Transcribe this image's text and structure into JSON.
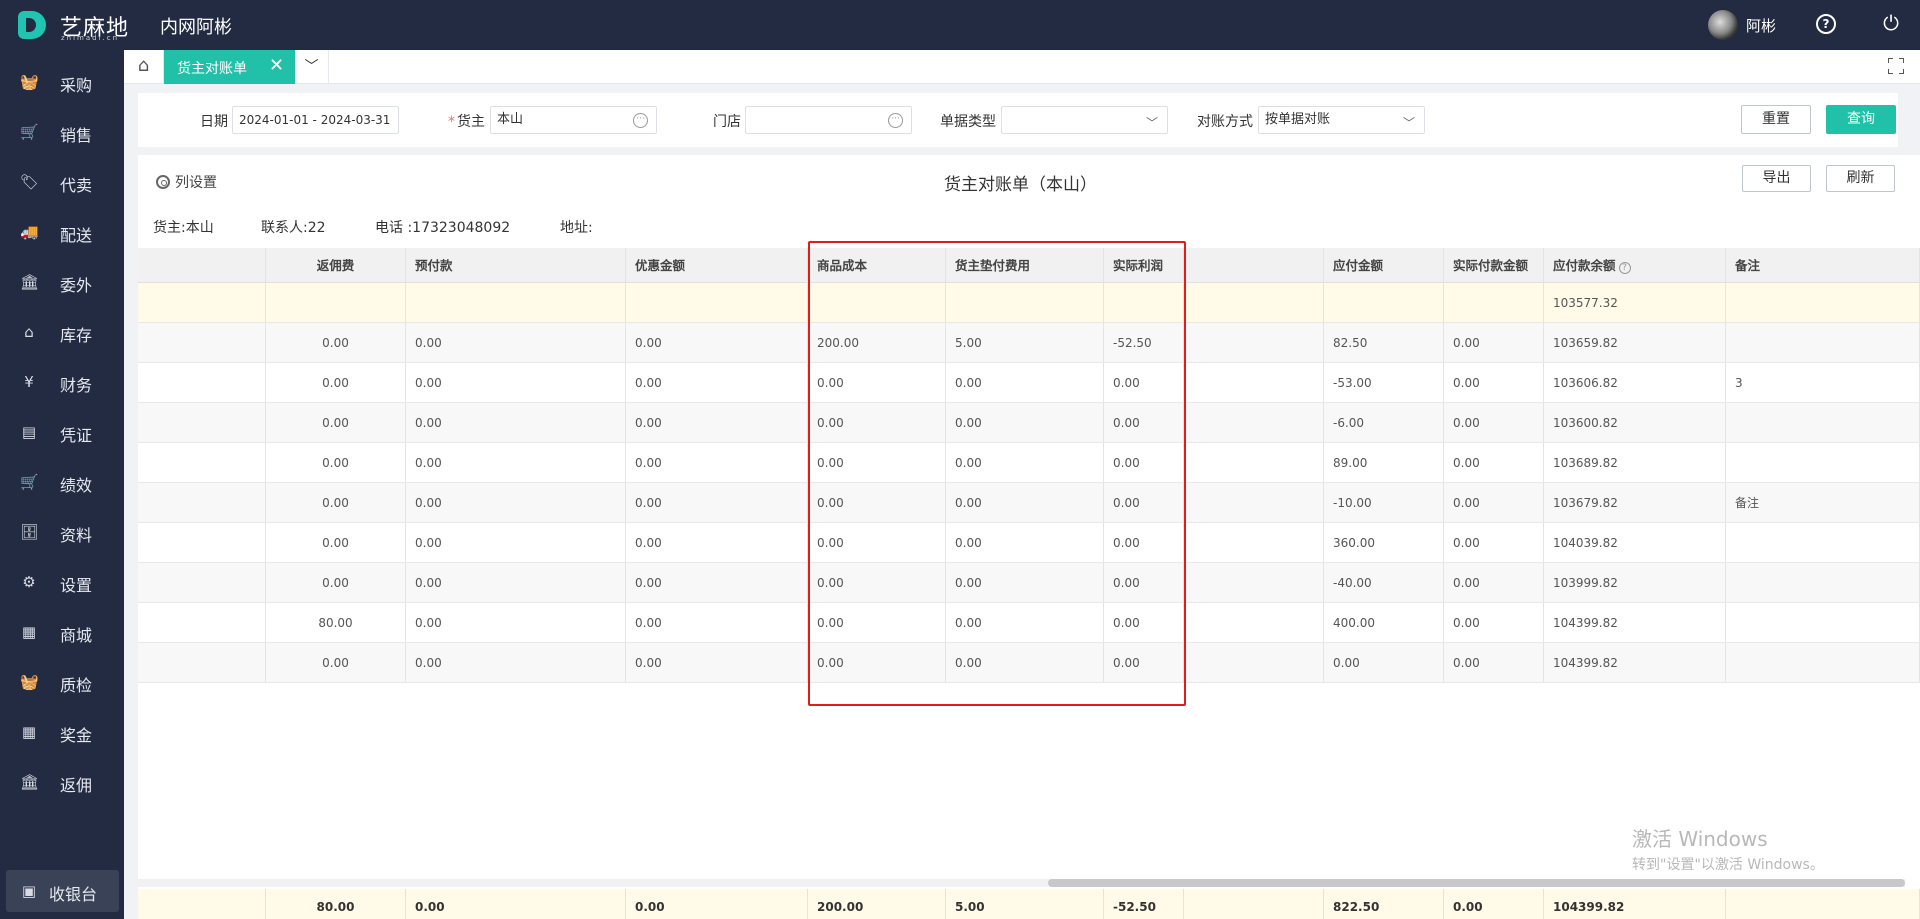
{
  "header": {
    "logo_text": "艺麻地",
    "logo_sub": "zhimadi.cn",
    "app_title": "内网阿彬",
    "user_name": "阿彬"
  },
  "sidebar": {
    "items": [
      {
        "label": "采购",
        "icon": "basket-icon"
      },
      {
        "label": "销售",
        "icon": "cart-icon"
      },
      {
        "label": "代卖",
        "icon": "tag-icon"
      },
      {
        "label": "配送",
        "icon": "truck-icon"
      },
      {
        "label": "委外",
        "icon": "building-icon"
      },
      {
        "label": "库存",
        "icon": "warehouse-icon"
      },
      {
        "label": "财务",
        "icon": "money-icon"
      },
      {
        "label": "凭证",
        "icon": "voucher-icon"
      },
      {
        "label": "绩效",
        "icon": "cart-icon"
      },
      {
        "label": "资料",
        "icon": "archive-icon"
      },
      {
        "label": "设置",
        "icon": "gear-icon"
      },
      {
        "label": "商城",
        "icon": "store-icon"
      },
      {
        "label": "质检",
        "icon": "basket-icon"
      },
      {
        "label": "奖金",
        "icon": "store-icon"
      },
      {
        "label": "返佣",
        "icon": "building-icon"
      }
    ],
    "cashier_label": "收银台"
  },
  "tabs": {
    "active_label": "货主对账单"
  },
  "filters": {
    "date_label": "日期",
    "date_value": "2024-01-01 - 2024-03-31",
    "owner_label": "货主",
    "owner_value": "本山",
    "store_label": "门店",
    "store_value": "",
    "doc_type_label": "单据类型",
    "doc_type_value": "",
    "recon_label": "对账方式",
    "recon_value": "按单据对账",
    "reset_label": "重置",
    "query_label": "查询"
  },
  "report": {
    "column_settings_label": "列设置",
    "title": "货主对账单（本山）",
    "export_label": "导出",
    "refresh_label": "刷新",
    "owner_info": "货主:本山",
    "contact_info": "联系人:22",
    "phone_info": "电话 :17323048092",
    "address_info": "地址:"
  },
  "table": {
    "columns": [
      "",
      "返佣费",
      "预付款",
      "优惠金额",
      "商品成本",
      "货主垫付费用",
      "实际利润",
      "",
      "应付金额",
      "实际付款金额",
      "应付款余额",
      "备注"
    ],
    "summary_row": [
      "",
      "",
      "",
      "",
      "",
      "",
      "",
      "",
      "",
      "",
      "103577.32",
      ""
    ],
    "rows": [
      [
        "",
        "0.00",
        "0.00",
        "0.00",
        "200.00",
        "5.00",
        "-52.50",
        "",
        "82.50",
        "0.00",
        "103659.82",
        ""
      ],
      [
        "",
        "0.00",
        "0.00",
        "0.00",
        "0.00",
        "0.00",
        "0.00",
        "",
        "-53.00",
        "0.00",
        "103606.82",
        "3"
      ],
      [
        "",
        "0.00",
        "0.00",
        "0.00",
        "0.00",
        "0.00",
        "0.00",
        "",
        "-6.00",
        "0.00",
        "103600.82",
        ""
      ],
      [
        "",
        "0.00",
        "0.00",
        "0.00",
        "0.00",
        "0.00",
        "0.00",
        "",
        "89.00",
        "0.00",
        "103689.82",
        ""
      ],
      [
        "",
        "0.00",
        "0.00",
        "0.00",
        "0.00",
        "0.00",
        "0.00",
        "",
        "-10.00",
        "0.00",
        "103679.82",
        "备注"
      ],
      [
        "",
        "0.00",
        "0.00",
        "0.00",
        "0.00",
        "0.00",
        "0.00",
        "",
        "360.00",
        "0.00",
        "104039.82",
        ""
      ],
      [
        "",
        "0.00",
        "0.00",
        "0.00",
        "0.00",
        "0.00",
        "0.00",
        "",
        "-40.00",
        "0.00",
        "103999.82",
        ""
      ],
      [
        "",
        "80.00",
        "0.00",
        "0.00",
        "0.00",
        "0.00",
        "0.00",
        "",
        "400.00",
        "0.00",
        "104399.82",
        ""
      ],
      [
        "",
        "0.00",
        "0.00",
        "0.00",
        "0.00",
        "0.00",
        "0.00",
        "",
        "0.00",
        "0.00",
        "104399.82",
        ""
      ]
    ],
    "totals": [
      "",
      "80.00",
      "0.00",
      "0.00",
      "200.00",
      "5.00",
      "-52.50",
      "",
      "822.50",
      "0.00",
      "104399.82",
      ""
    ]
  },
  "watermark": {
    "line1": "激活 Windows",
    "line2": "转到\"设置\"以激活 Windows。"
  },
  "colors": {
    "sidebar_bg": "#222b41",
    "accent": "#21c1a9",
    "highlight_border": "#e31b1b",
    "summary_bg": "#fffbe8"
  }
}
